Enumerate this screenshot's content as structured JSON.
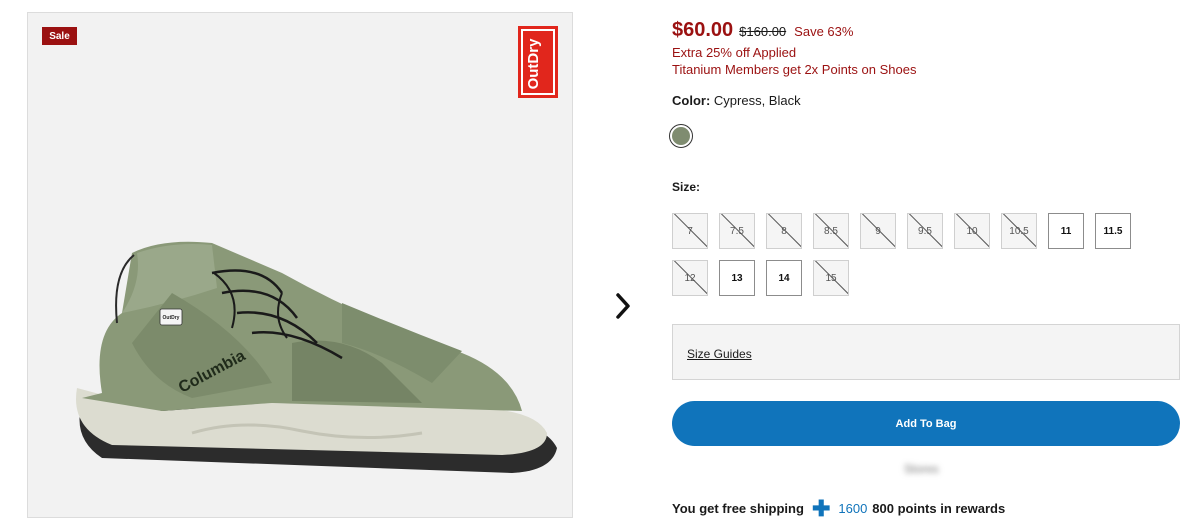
{
  "product_image": {
    "sale_badge": "Sale",
    "brand_badge_text": "OutDry",
    "shoe_brand_text": "Columbia",
    "shoe_tag_text": "OutDry",
    "carousel_next_icon": "chevron-right-icon"
  },
  "pricing": {
    "current_price": "$60.00",
    "original_price": "$160.00",
    "savings": "Save 63%",
    "promo_applied": "Extra 25% off Applied",
    "member_promo": "Titanium Members get 2x Points on Shoes"
  },
  "color": {
    "label": "Color:",
    "value": "Cypress, Black",
    "swatch_color": "#7f8c70"
  },
  "sizes": {
    "label": "Size:",
    "options": [
      {
        "size": "7",
        "available": false
      },
      {
        "size": "7.5",
        "available": false
      },
      {
        "size": "8",
        "available": false
      },
      {
        "size": "8.5",
        "available": false
      },
      {
        "size": "9",
        "available": false
      },
      {
        "size": "9.5",
        "available": false
      },
      {
        "size": "10",
        "available": false
      },
      {
        "size": "10.5",
        "available": false
      },
      {
        "size": "11",
        "available": true
      },
      {
        "size": "11.5",
        "available": true
      },
      {
        "size": "12",
        "available": false
      },
      {
        "size": "13",
        "available": true
      },
      {
        "size": "14",
        "available": true
      },
      {
        "size": "15",
        "available": false
      }
    ]
  },
  "size_guides": {
    "label": "Size Guides"
  },
  "cart": {
    "add_to_bag_label": "Add To Bag",
    "blurred_link": "Stores"
  },
  "rewards": {
    "free_shipping": "You get free shipping",
    "plus_icon": "plus-icon",
    "points_original": "1600",
    "points_text": "800 points in rewards"
  },
  "colors": {
    "sale_red": "#9b1111",
    "accent_blue": "#1074bb",
    "badge_red": "#e1261c"
  }
}
